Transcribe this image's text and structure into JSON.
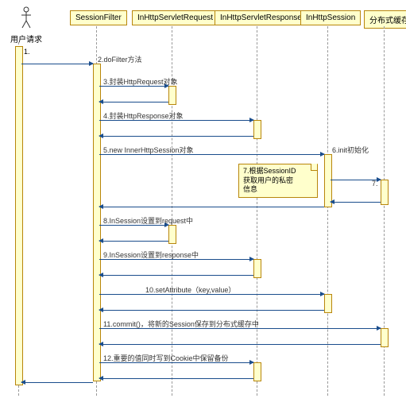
{
  "actor": {
    "label": "用户请求"
  },
  "participants": {
    "p1": "SessionFilter",
    "p2": "InHttpServletRequest",
    "p3": "InHttpServletResponse",
    "p4": "InHttpSession",
    "p5": "分布式缓存"
  },
  "seq": {
    "s1": "1.",
    "s2": "2.doFilter方法",
    "s3": "3.封装HttpRequest对象",
    "s4": "4.封装HttpResponse对象",
    "s5": "5.new InnerHttpSession对象",
    "s6": "6.init初始化",
    "s7": "7.",
    "s7note_l1": "7.根据SessionID",
    "s7note_l2": "获取用户的私密",
    "s7note_l3": "信息",
    "s8": "8.InSession设置到request中",
    "s9": "9.InSession设置到response中",
    "s10": "10.setAttribute（key,value）",
    "s11": "11.commit()，将新的Session保存到分布式缓存中",
    "s12": "12.重要的值同时写到Cookie中保留备份"
  },
  "chart_data": {
    "type": "sequence_diagram",
    "actor": "用户请求",
    "participants": [
      "SessionFilter",
      "InHttpServletRequest",
      "InHttpServletResponse",
      "InHttpSession",
      "分布式缓存"
    ],
    "messages": [
      {
        "n": 1,
        "from": "用户请求",
        "to": "用户请求",
        "label": ""
      },
      {
        "n": 2,
        "from": "用户请求",
        "to": "SessionFilter",
        "label": "doFilter方法"
      },
      {
        "n": 3,
        "from": "SessionFilter",
        "to": "InHttpServletRequest",
        "label": "封装HttpRequest对象"
      },
      {
        "n": 4,
        "from": "SessionFilter",
        "to": "InHttpServletResponse",
        "label": "封装HttpResponse对象"
      },
      {
        "n": 5,
        "from": "SessionFilter",
        "to": "InHttpSession",
        "label": "new InnerHttpSession对象"
      },
      {
        "n": 6,
        "from": "InHttpSession",
        "to": "InHttpSession",
        "label": "init初始化"
      },
      {
        "n": 7,
        "from": "InHttpSession",
        "to": "分布式缓存",
        "label": "",
        "note": "根据SessionID获取用户的私密信息"
      },
      {
        "n": 8,
        "from": "SessionFilter",
        "to": "InHttpServletRequest",
        "label": "InSession设置到request中"
      },
      {
        "n": 9,
        "from": "SessionFilter",
        "to": "InHttpServletResponse",
        "label": "InSession设置到response中"
      },
      {
        "n": 10,
        "from": "SessionFilter",
        "to": "InHttpSession",
        "label": "setAttribute（key,value）"
      },
      {
        "n": 11,
        "from": "SessionFilter",
        "to": "分布式缓存",
        "label": "commit()，将新的Session保存到分布式缓存中"
      },
      {
        "n": 12,
        "from": "SessionFilter",
        "to": "InHttpServletResponse",
        "label": "重要的值同时写到Cookie中保留备份"
      }
    ]
  }
}
